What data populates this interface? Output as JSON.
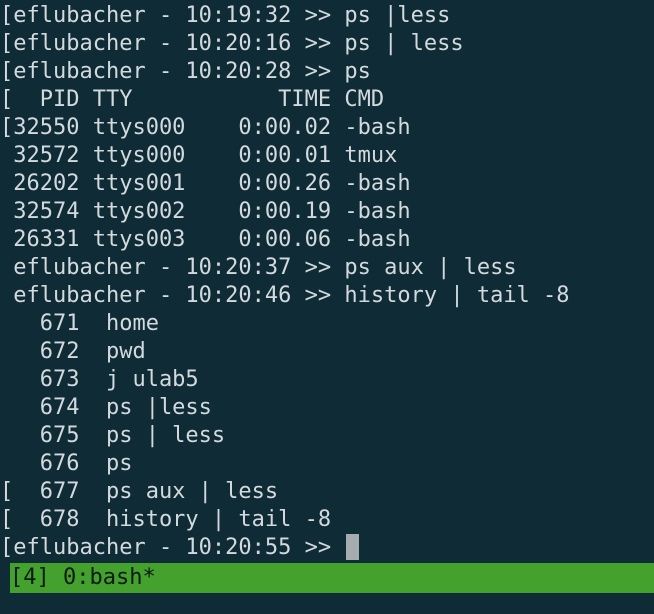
{
  "terminal": {
    "lines": [
      "[eflubacher - 10:19:32 >> ps |less",
      "[eflubacher - 10:20:16 >> ps | less",
      "[eflubacher - 10:20:28 >> ps",
      "[  PID TTY           TIME CMD",
      "[32550 ttys000    0:00.02 -bash",
      " 32572 ttys000    0:00.01 tmux",
      " 26202 ttys001    0:00.26 -bash",
      " 32574 ttys002    0:00.19 -bash",
      " 26331 ttys003    0:00.06 -bash",
      " eflubacher - 10:20:37 >> ps aux | less",
      " eflubacher - 10:20:46 >> history | tail -8",
      "   671  home",
      "   672  pwd",
      "   673  j ulab5",
      "   674  ps |less",
      "   675  ps | less",
      "   676  ps",
      "[  677  ps aux | less",
      "[  678  history | tail -8"
    ],
    "prompt": "[eflubacher - 10:20:55 >> "
  },
  "status_bar": {
    "text": "[4] 0:bash*"
  },
  "colors": {
    "background": "#0f2b36",
    "foreground": "#d3dadd",
    "status_bar": "#44a12e",
    "cursor": "#a5acae"
  }
}
